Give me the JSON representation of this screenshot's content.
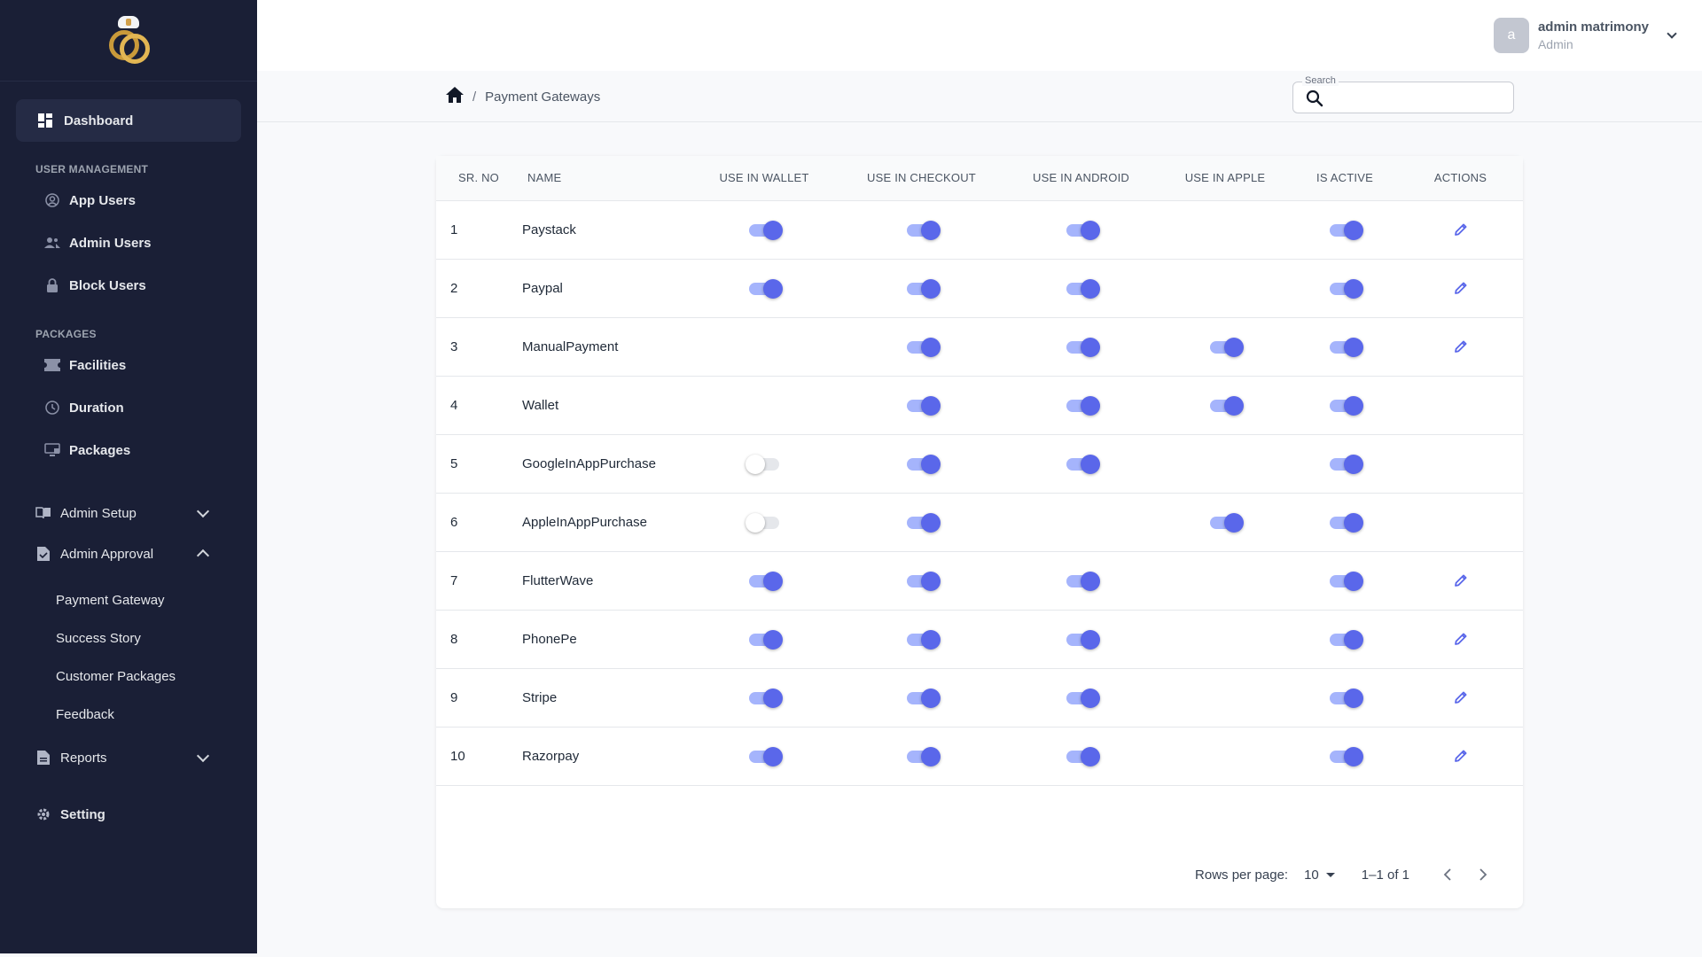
{
  "sidebar": {
    "dashboard": "Dashboard",
    "sections": {
      "user_management": "USER MANAGEMENT",
      "packages": "PACKAGES"
    },
    "user_items": [
      "App Users",
      "Admin Users",
      "Block Users"
    ],
    "package_items": [
      "Facilities",
      "Duration",
      "Packages"
    ],
    "admin_setup": "Admin Setup",
    "admin_approval": "Admin Approval",
    "approval_items": [
      "Payment Gateway",
      "Success Story",
      "Customer Packages",
      "Feedback"
    ],
    "reports": "Reports",
    "setting": "Setting"
  },
  "header": {
    "avatar_letter": "a",
    "user_name": "admin matrimony",
    "user_role": "Admin"
  },
  "breadcrumb": {
    "current": "Payment Gateways",
    "separator": "/"
  },
  "search": {
    "label": "Search",
    "value": ""
  },
  "table": {
    "columns": [
      "SR. NO",
      "NAME",
      "USE IN WALLET",
      "USE IN CHECKOUT",
      "USE IN ANDROID",
      "USE IN APPLE",
      "IS ACTIVE",
      "ACTIONS"
    ],
    "rows": [
      {
        "sr": "1",
        "name": "Paystack",
        "wallet": true,
        "checkout": true,
        "android": true,
        "apple": null,
        "active": true,
        "edit": true
      },
      {
        "sr": "2",
        "name": "Paypal",
        "wallet": true,
        "checkout": true,
        "android": true,
        "apple": null,
        "active": true,
        "edit": true
      },
      {
        "sr": "3",
        "name": "ManualPayment",
        "wallet": null,
        "checkout": true,
        "android": true,
        "apple": true,
        "active": true,
        "edit": true
      },
      {
        "sr": "4",
        "name": "Wallet",
        "wallet": null,
        "checkout": true,
        "android": true,
        "apple": true,
        "active": true,
        "edit": false
      },
      {
        "sr": "5",
        "name": "GoogleInAppPurchase",
        "wallet": false,
        "checkout": true,
        "android": true,
        "apple": null,
        "active": true,
        "edit": false
      },
      {
        "sr": "6",
        "name": "AppleInAppPurchase",
        "wallet": false,
        "checkout": true,
        "android": null,
        "apple": true,
        "active": true,
        "edit": false
      },
      {
        "sr": "7",
        "name": "FlutterWave",
        "wallet": true,
        "checkout": true,
        "android": true,
        "apple": null,
        "active": true,
        "edit": true
      },
      {
        "sr": "8",
        "name": "PhonePe",
        "wallet": true,
        "checkout": true,
        "android": true,
        "apple": null,
        "active": true,
        "edit": true
      },
      {
        "sr": "9",
        "name": "Stripe",
        "wallet": true,
        "checkout": true,
        "android": true,
        "apple": null,
        "active": true,
        "edit": true
      },
      {
        "sr": "10",
        "name": "Razorpay",
        "wallet": true,
        "checkout": true,
        "android": true,
        "apple": null,
        "active": true,
        "edit": true
      }
    ]
  },
  "pagination": {
    "rows_per_page_label": "Rows per page:",
    "rows_per_page": "10",
    "range": "1–1 of 1"
  },
  "colors": {
    "sidebar_bg": "#1a1f36",
    "accent": "#5a67ea",
    "toggle_track": "#a5b4fc"
  },
  "icons": {
    "home": "home-icon",
    "search": "search-icon",
    "edit": "edit-pencil-icon"
  }
}
